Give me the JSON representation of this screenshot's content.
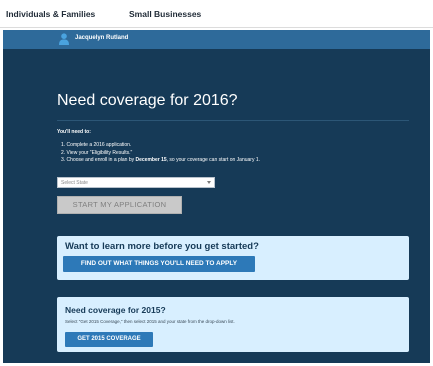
{
  "nav": {
    "individuals_families": "Individuals & Families",
    "small_businesses": "Small Businesses"
  },
  "user": {
    "name": "Jacquelyn Rutland",
    "icon": "user-icon"
  },
  "main": {
    "title": "Need coverage for 2016?",
    "need_label": "You'll need to:",
    "steps": [
      {
        "text": "1. Complete a 2016 application."
      },
      {
        "text": "2. View your \"Eligibility Results.\""
      },
      {
        "text_before": "3. Choose and enroll in a plan by ",
        "bold": "December 15",
        "text_after": ", so your coverage can start on January 1."
      }
    ],
    "state_select": {
      "placeholder": "Select State"
    },
    "start_button": "START MY APPLICATION"
  },
  "learn_card": {
    "title": "Want to learn more before you get started?",
    "button": "FIND OUT WHAT THINGS YOU'LL NEED TO APPLY"
  },
  "coverage_2015_card": {
    "title": "Need coverage for 2015?",
    "text": "Select \"Get 2015 Coverage,\" then select 2015 and your state from the drop-down list.",
    "button": "GET 2015 COVERAGE"
  },
  "colors": {
    "panel_bg": "#163a57",
    "user_bar": "#2e6a9a",
    "card_bg": "#d8efff",
    "button_blue": "#2d79b8",
    "disabled_button": "#c9c9c9",
    "user_icon": "#4aa3df"
  }
}
